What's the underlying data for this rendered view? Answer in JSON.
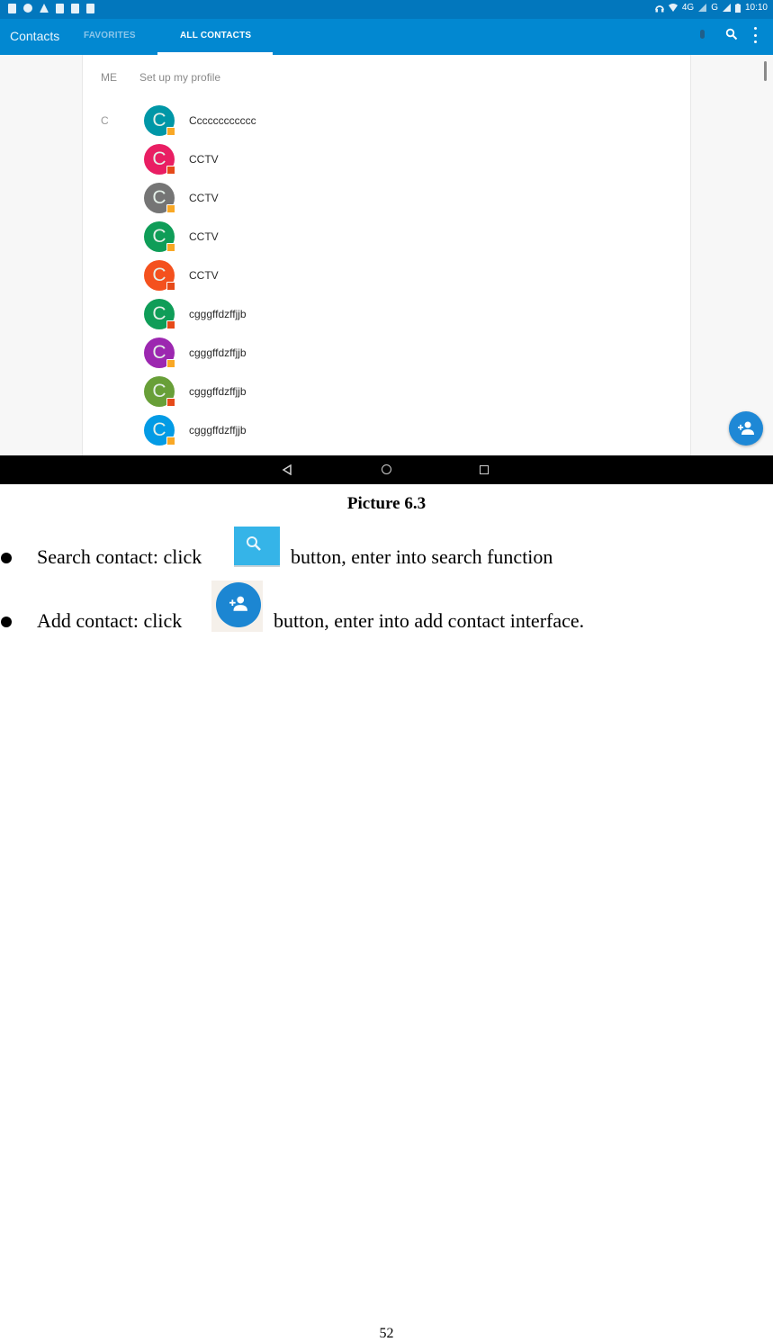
{
  "screenshot": {
    "status_bar": {
      "network": "4G",
      "network2": "G",
      "time": "10:10"
    },
    "app_bar": {
      "title": "Contacts",
      "tabs": [
        {
          "label": "FAVORITES",
          "selected": false
        },
        {
          "label": "ALL CONTACTS",
          "selected": true
        }
      ],
      "actions": [
        "mic-icon",
        "search-icon",
        "more-options-icon"
      ]
    },
    "me_section": {
      "label": "ME",
      "profile_text": "Set up my profile"
    },
    "section_letter": "C",
    "contacts": [
      {
        "initial": "C",
        "name": "Cccccccccccc",
        "color": "#0097a7",
        "badge": "#f9a825"
      },
      {
        "initial": "C",
        "name": "CCTV",
        "color": "#e91e63",
        "badge": "#e64a19"
      },
      {
        "initial": "C",
        "name": "CCTV",
        "color": "#757575",
        "badge": "#f9a825"
      },
      {
        "initial": "C",
        "name": "CCTV",
        "color": "#0f9d58",
        "badge": "#f9a825"
      },
      {
        "initial": "C",
        "name": "CCTV",
        "color": "#f4511e",
        "badge": "#e64a19"
      },
      {
        "initial": "C",
        "name": "cgggffdzffjjb",
        "color": "#0f9d58",
        "badge": "#e64a19"
      },
      {
        "initial": "C",
        "name": "cgggffdzffjjb",
        "color": "#9c27b0",
        "badge": "#f9a825"
      },
      {
        "initial": "C",
        "name": "cgggffdzffjjb",
        "color": "#689f38",
        "badge": "#e64a19"
      },
      {
        "initial": "C",
        "name": "cgggffdzffjjb",
        "color": "#039be5",
        "badge": "#f9a825"
      }
    ],
    "fab": {
      "icon": "add-contact-icon"
    },
    "nav_bar": [
      "back-icon",
      "home-icon",
      "recents-icon"
    ]
  },
  "document": {
    "caption": "Picture 6.3",
    "bullets": [
      {
        "before": "Search contact: click",
        "icon": "search-button-icon",
        "after": "button, enter into search function"
      },
      {
        "before": "Add contact: click",
        "icon": "add-contact-button-icon",
        "after": "button, enter into add contact interface."
      }
    ],
    "page_number": "52"
  }
}
